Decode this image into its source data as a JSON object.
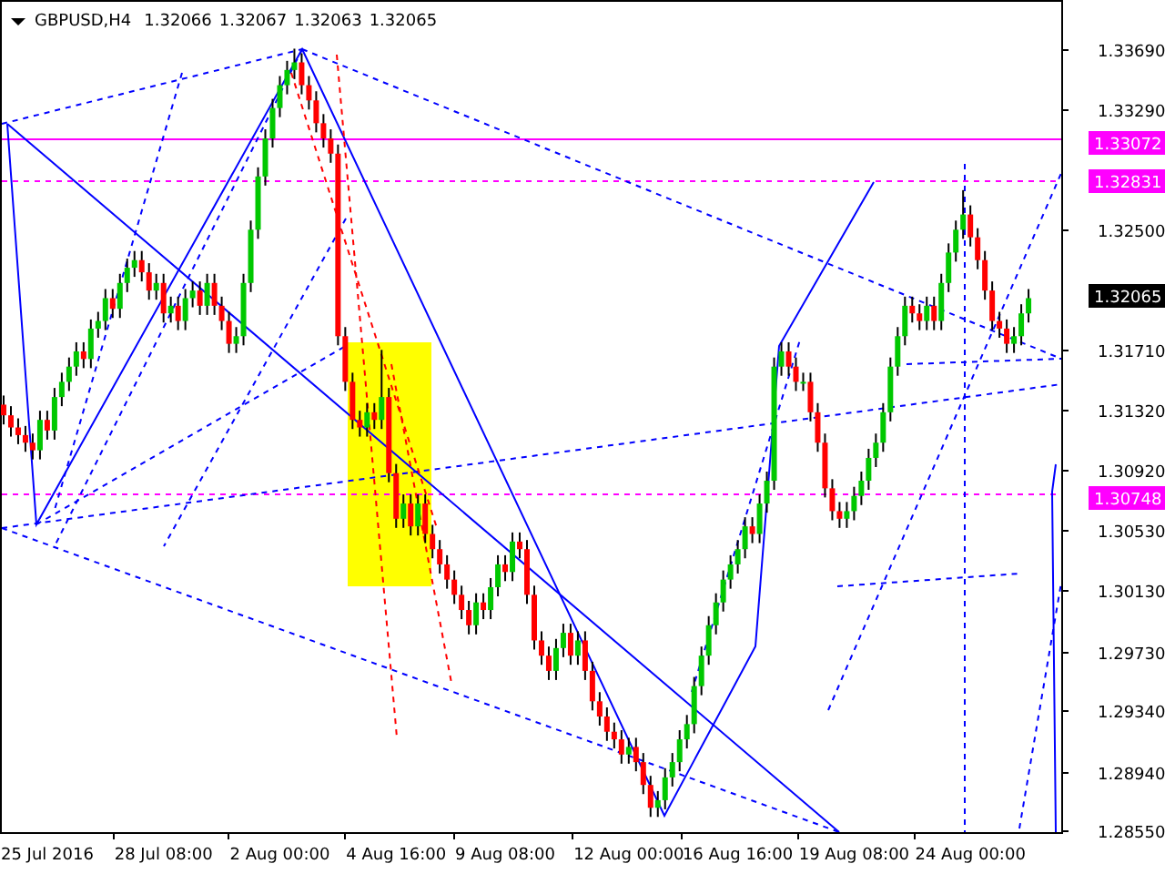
{
  "header": {
    "symbol": "GBPUSD,H4",
    "quotes": [
      "1.32066",
      "1.32067",
      "1.32063",
      "1.32065"
    ]
  },
  "price_badges": [
    {
      "text": "1.33072",
      "color": "#ff00ff"
    },
    {
      "text": "1.32831",
      "color": "#ff00ff"
    },
    {
      "text": "1.32065",
      "color": "#000000"
    },
    {
      "text": "1.30748",
      "color": "#ff00ff"
    }
  ],
  "chart_data": {
    "type": "candlestick",
    "categories": [
      null,
      null,
      null,
      null,
      null,
      null,
      "25 Jul 2016",
      null,
      null,
      null,
      null,
      null,
      null,
      null,
      null,
      null,
      null,
      null,
      null,
      null,
      null,
      null,
      "28 Jul 08:00",
      null,
      null,
      null,
      null,
      null,
      null,
      null,
      null,
      null,
      null,
      null,
      null,
      null,
      null,
      null,
      "2 Aug 00:00",
      null,
      null,
      null,
      null,
      null,
      null,
      null,
      null,
      null,
      null,
      null,
      null,
      null,
      null,
      null,
      "4 Aug 16:00",
      null,
      null,
      null,
      null,
      null,
      null,
      null,
      null,
      null,
      null,
      null,
      null,
      null,
      null,
      "9 Aug 08:00",
      null,
      null,
      null,
      null,
      null,
      null,
      null,
      null,
      null,
      null,
      null,
      null,
      null,
      null,
      null,
      null,
      "12 Aug 00:00",
      null,
      null,
      null,
      null,
      null,
      null,
      null,
      null,
      null,
      null,
      null,
      null,
      null,
      null,
      "16 Aug 16:00",
      null,
      null,
      null,
      null,
      null,
      null,
      null,
      null,
      null,
      null,
      null,
      null,
      null,
      null,
      null,
      "19 Aug 08:00",
      null,
      null,
      null,
      null,
      null,
      null,
      null,
      null,
      null,
      null,
      null,
      null,
      null,
      null,
      null,
      "24 Aug 00:00",
      null,
      null,
      null,
      null,
      null,
      null,
      null,
      null,
      null,
      null,
      null,
      null
    ],
    "ylim": [
      1.2854,
      1.3401
    ],
    "ohlc": [
      [
        1.3135,
        1.3141,
        1.3122,
        1.3128
      ],
      [
        1.3128,
        1.3134,
        1.3114,
        1.312
      ],
      [
        1.312,
        1.3126,
        1.3109,
        1.3115
      ],
      [
        1.3115,
        1.3121,
        1.3104,
        1.311
      ],
      [
        1.311,
        1.3116,
        1.3099,
        1.3105
      ],
      [
        1.3105,
        1.3131,
        1.3099,
        1.3125
      ],
      [
        1.3125,
        1.3131,
        1.3112,
        1.3118
      ],
      [
        1.3118,
        1.3146,
        1.3112,
        1.314
      ],
      [
        1.314,
        1.3156,
        1.3134,
        1.315
      ],
      [
        1.315,
        1.3166,
        1.3144,
        1.316
      ],
      [
        1.316,
        1.3176,
        1.3154,
        1.317
      ],
      [
        1.317,
        1.3176,
        1.3159,
        1.3165
      ],
      [
        1.3165,
        1.3191,
        1.3159,
        1.3185
      ],
      [
        1.3185,
        1.3196,
        1.3179,
        1.319
      ],
      [
        1.319,
        1.3211,
        1.3184,
        1.3205
      ],
      [
        1.3205,
        1.3211,
        1.3192,
        1.3198
      ],
      [
        1.3198,
        1.3221,
        1.3192,
        1.3215
      ],
      [
        1.3215,
        1.3231,
        1.3209,
        1.3225
      ],
      [
        1.3225,
        1.3236,
        1.3219,
        1.323
      ],
      [
        1.323,
        1.3236,
        1.3216,
        1.3222
      ],
      [
        1.3222,
        1.3228,
        1.3204,
        1.321
      ],
      [
        1.321,
        1.3221,
        1.3204,
        1.3215
      ],
      [
        1.3215,
        1.3221,
        1.3189,
        1.3195
      ],
      [
        1.3195,
        1.3206,
        1.3189,
        1.32
      ],
      [
        1.32,
        1.3206,
        1.3184,
        1.319
      ],
      [
        1.319,
        1.3211,
        1.3184,
        1.3205
      ],
      [
        1.3205,
        1.3216,
        1.3199,
        1.321
      ],
      [
        1.321,
        1.3216,
        1.3194,
        1.32
      ],
      [
        1.32,
        1.3221,
        1.3194,
        1.3215
      ],
      [
        1.3215,
        1.3221,
        1.3194,
        1.32
      ],
      [
        1.32,
        1.3206,
        1.3184,
        1.319
      ],
      [
        1.319,
        1.3196,
        1.3169,
        1.3175
      ],
      [
        1.3175,
        1.3186,
        1.3169,
        1.318
      ],
      [
        1.318,
        1.3221,
        1.3174,
        1.3215
      ],
      [
        1.3215,
        1.3256,
        1.3209,
        1.325
      ],
      [
        1.325,
        1.3291,
        1.3244,
        1.3285
      ],
      [
        1.3285,
        1.3316,
        1.3279,
        1.331
      ],
      [
        1.331,
        1.3336,
        1.3304,
        1.333
      ],
      [
        1.333,
        1.3351,
        1.3324,
        1.3345
      ],
      [
        1.3345,
        1.3361,
        1.3339,
        1.3355
      ],
      [
        1.3355,
        1.3369,
        1.3349,
        1.336
      ],
      [
        1.336,
        1.3366,
        1.3339,
        1.3345
      ],
      [
        1.3345,
        1.3351,
        1.3329,
        1.3335
      ],
      [
        1.3335,
        1.3341,
        1.3314,
        1.332
      ],
      [
        1.332,
        1.3326,
        1.3304,
        1.331
      ],
      [
        1.331,
        1.3316,
        1.3294,
        1.33
      ],
      [
        1.33,
        1.3306,
        1.3174,
        1.318
      ],
      [
        1.318,
        1.3186,
        1.3144,
        1.315
      ],
      [
        1.315,
        1.3156,
        1.3119,
        1.3125
      ],
      [
        1.3125,
        1.3131,
        1.3114,
        1.312
      ],
      [
        1.312,
        1.3136,
        1.3114,
        1.313
      ],
      [
        1.313,
        1.3136,
        1.3119,
        1.3125
      ],
      [
        1.3125,
        1.3171,
        1.3119,
        1.314
      ],
      [
        1.314,
        1.3146,
        1.3084,
        1.309
      ],
      [
        1.309,
        1.3096,
        1.3054,
        1.306
      ],
      [
        1.306,
        1.3076,
        1.3054,
        1.307
      ],
      [
        1.307,
        1.3076,
        1.3049,
        1.3055
      ],
      [
        1.3055,
        1.3076,
        1.3049,
        1.307
      ],
      [
        1.307,
        1.3076,
        1.3044,
        1.305
      ],
      [
        1.305,
        1.3056,
        1.3034,
        1.304
      ],
      [
        1.304,
        1.3046,
        1.3024,
        1.303
      ],
      [
        1.303,
        1.3036,
        1.3014,
        1.302
      ],
      [
        1.302,
        1.3026,
        1.3004,
        1.301
      ],
      [
        1.301,
        1.3016,
        1.2994,
        1.3
      ],
      [
        1.3,
        1.3006,
        1.2984,
        1.299
      ],
      [
        1.299,
        1.3011,
        1.2984,
        1.3005
      ],
      [
        1.3005,
        1.3011,
        1.2994,
        1.3
      ],
      [
        1.3,
        1.3021,
        1.2994,
        1.3015
      ],
      [
        1.3015,
        1.3036,
        1.3009,
        1.303
      ],
      [
        1.303,
        1.3036,
        1.3019,
        1.3025
      ],
      [
        1.3025,
        1.3051,
        1.3019,
        1.3045
      ],
      [
        1.3045,
        1.3051,
        1.3034,
        1.304
      ],
      [
        1.304,
        1.3046,
        1.3004,
        1.301
      ],
      [
        1.301,
        1.3016,
        1.2974,
        1.298
      ],
      [
        1.298,
        1.2986,
        1.2964,
        1.297
      ],
      [
        1.297,
        1.2976,
        1.2954,
        1.296
      ],
      [
        1.296,
        1.2981,
        1.2954,
        1.2975
      ],
      [
        1.2975,
        1.2991,
        1.2969,
        1.2985
      ],
      [
        1.2985,
        1.2991,
        1.2964,
        1.297
      ],
      [
        1.297,
        1.2986,
        1.2964,
        1.298
      ],
      [
        1.298,
        1.2986,
        1.2954,
        1.296
      ],
      [
        1.296,
        1.2966,
        1.2934,
        1.294
      ],
      [
        1.294,
        1.2946,
        1.2924,
        1.293
      ],
      [
        1.293,
        1.2936,
        1.2914,
        1.292
      ],
      [
        1.292,
        1.2926,
        1.2909,
        1.2915
      ],
      [
        1.2915,
        1.2921,
        1.2899,
        1.2905
      ],
      [
        1.2905,
        1.2916,
        1.2899,
        1.291
      ],
      [
        1.291,
        1.2916,
        1.2894,
        1.29
      ],
      [
        1.29,
        1.2906,
        1.2879,
        1.2885
      ],
      [
        1.2885,
        1.2891,
        1.2864,
        1.287
      ],
      [
        1.287,
        1.2881,
        1.2864,
        1.2875
      ],
      [
        1.2875,
        1.2896,
        1.2869,
        1.289
      ],
      [
        1.289,
        1.2906,
        1.2884,
        1.29
      ],
      [
        1.29,
        1.2921,
        1.2894,
        1.2915
      ],
      [
        1.2915,
        1.2931,
        1.2909,
        1.2925
      ],
      [
        1.2925,
        1.2956,
        1.2919,
        1.295
      ],
      [
        1.295,
        1.2976,
        1.2944,
        1.297
      ],
      [
        1.297,
        1.2996,
        1.2964,
        1.299
      ],
      [
        1.299,
        1.3011,
        1.2984,
        1.3005
      ],
      [
        1.3005,
        1.3026,
        1.2999,
        1.302
      ],
      [
        1.302,
        1.3036,
        1.3014,
        1.303
      ],
      [
        1.303,
        1.3046,
        1.3024,
        1.304
      ],
      [
        1.304,
        1.3061,
        1.3034,
        1.3055
      ],
      [
        1.3055,
        1.3061,
        1.3044,
        1.305
      ],
      [
        1.305,
        1.3076,
        1.3044,
        1.307
      ],
      [
        1.307,
        1.3091,
        1.3064,
        1.3085
      ],
      [
        1.3085,
        1.3166,
        1.3079,
        1.316
      ],
      [
        1.316,
        1.3176,
        1.3154,
        1.317
      ],
      [
        1.317,
        1.3176,
        1.3154,
        1.316
      ],
      [
        1.316,
        1.3166,
        1.3144,
        1.315
      ],
      [
        1.315,
        1.3156,
        1.3144,
        1.315
      ],
      [
        1.315,
        1.3156,
        1.3124,
        1.313
      ],
      [
        1.313,
        1.3136,
        1.3104,
        1.311
      ],
      [
        1.311,
        1.3116,
        1.3074,
        1.308
      ],
      [
        1.308,
        1.3086,
        1.3059,
        1.3065
      ],
      [
        1.3065,
        1.3071,
        1.3054,
        1.306
      ],
      [
        1.306,
        1.3071,
        1.3054,
        1.3065
      ],
      [
        1.3065,
        1.3081,
        1.3059,
        1.3075
      ],
      [
        1.3075,
        1.3091,
        1.3069,
        1.3085
      ],
      [
        1.3085,
        1.3106,
        1.3079,
        1.31
      ],
      [
        1.31,
        1.3116,
        1.3094,
        1.311
      ],
      [
        1.311,
        1.3136,
        1.3104,
        1.313
      ],
      [
        1.313,
        1.3166,
        1.3124,
        1.316
      ],
      [
        1.316,
        1.3186,
        1.3154,
        1.318
      ],
      [
        1.318,
        1.3206,
        1.3174,
        1.32
      ],
      [
        1.32,
        1.3206,
        1.3189,
        1.3195
      ],
      [
        1.3195,
        1.3201,
        1.3184,
        1.319
      ],
      [
        1.319,
        1.3206,
        1.3184,
        1.32
      ],
      [
        1.32,
        1.3206,
        1.3184,
        1.319
      ],
      [
        1.319,
        1.3221,
        1.3184,
        1.3215
      ],
      [
        1.3215,
        1.3241,
        1.3209,
        1.3235
      ],
      [
        1.3235,
        1.3256,
        1.3229,
        1.325
      ],
      [
        1.325,
        1.3276,
        1.3244,
        1.326
      ],
      [
        1.326,
        1.3266,
        1.3239,
        1.3245
      ],
      [
        1.3245,
        1.3251,
        1.3224,
        1.323
      ],
      [
        1.323,
        1.3236,
        1.3204,
        1.321
      ],
      [
        1.321,
        1.3216,
        1.3184,
        1.319
      ],
      [
        1.319,
        1.3196,
        1.3179,
        1.3185
      ],
      [
        1.3185,
        1.3191,
        1.3169,
        1.3175
      ],
      [
        1.3175,
        1.3186,
        1.3169,
        1.318
      ],
      [
        1.318,
        1.3201,
        1.3174,
        1.3195
      ],
      [
        1.3195,
        1.3211,
        1.3189,
        1.3205
      ],
      null,
      null,
      null,
      null
    ],
    "yticks": [
      {
        "value": 1.3369,
        "label": "1.33690"
      },
      {
        "value": 1.3329,
        "label": "1.33290"
      },
      {
        "value": 1.325,
        "label": "1.32500"
      },
      {
        "value": 1.3171,
        "label": "1.31710"
      },
      {
        "value": 1.3132,
        "label": "1.31320"
      },
      {
        "value": 1.3092,
        "label": "1.30920"
      },
      {
        "value": 1.3053,
        "label": "1.30530"
      },
      {
        "value": 1.3013,
        "label": "1.30130"
      },
      {
        "value": 1.2973,
        "label": "1.29730"
      },
      {
        "value": 1.2934,
        "label": "1.29340"
      },
      {
        "value": 1.2894,
        "label": "1.28940"
      },
      {
        "value": 1.2855,
        "label": "1.28550"
      }
    ]
  }
}
